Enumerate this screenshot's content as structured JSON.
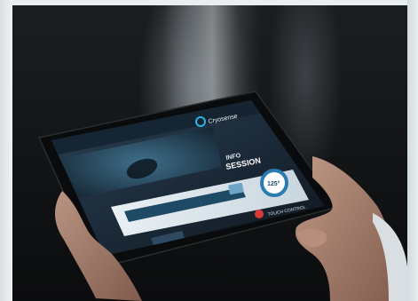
{
  "brand": {
    "name": "Cryosense",
    "accent": "#2ab3e6"
  },
  "screen": {
    "session_label_line1": "INFO",
    "session_label_line2": "SESSION",
    "temperature": "125°",
    "control_label": "TOUCH CONTROL"
  }
}
